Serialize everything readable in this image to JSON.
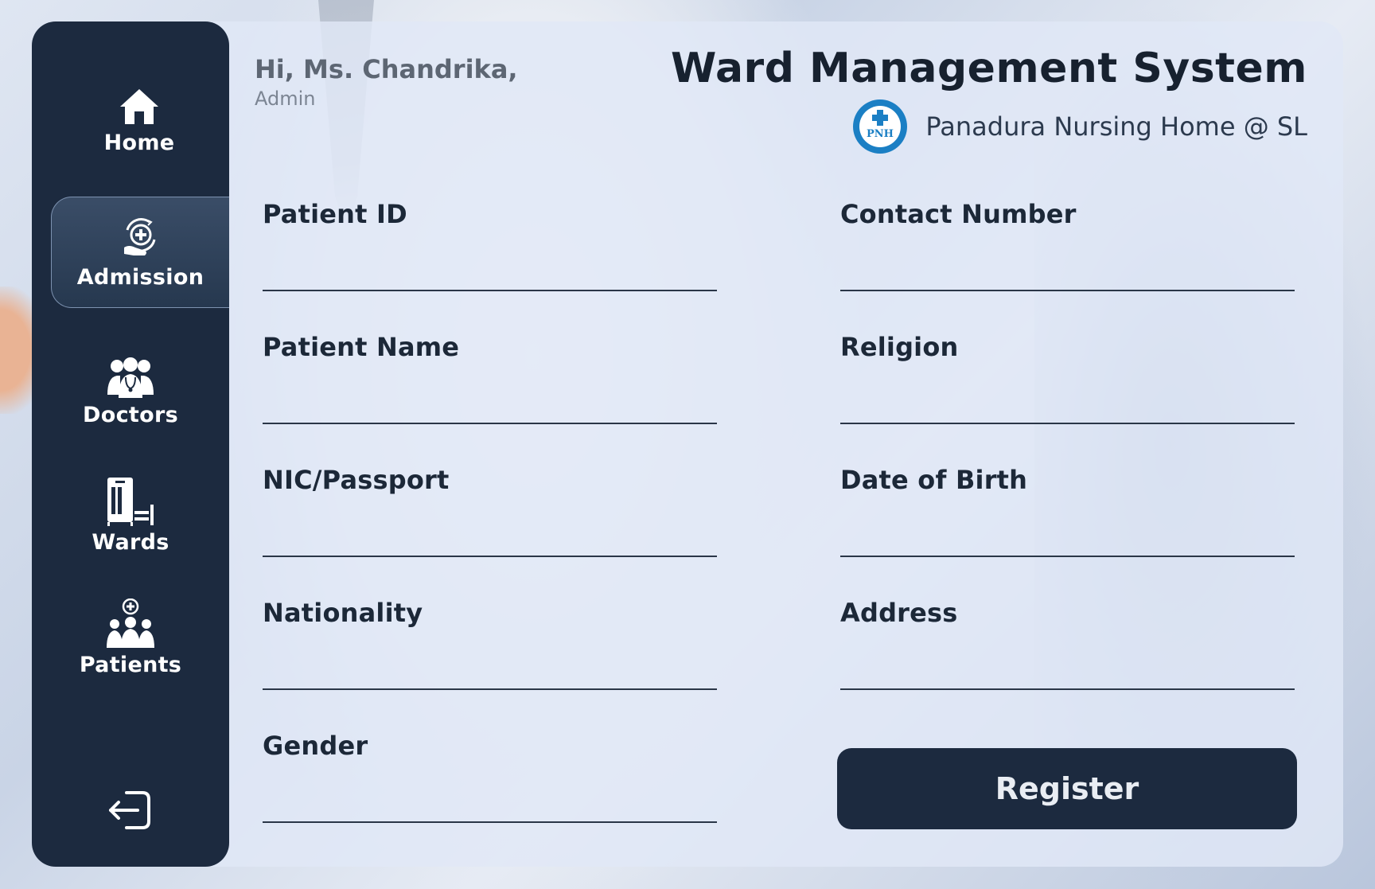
{
  "header": {
    "greeting": "Hi, Ms. Chandrika,",
    "role": "Admin",
    "app_title": "Ward Management System",
    "org_name": "Panadura Nursing Home @ SL",
    "logo_text": "PNH"
  },
  "sidebar": {
    "items": [
      {
        "label": "Home",
        "icon": "home-icon"
      },
      {
        "label": "Admission",
        "icon": "admission-icon",
        "active": true
      },
      {
        "label": "Doctors",
        "icon": "doctors-icon"
      },
      {
        "label": "Wards",
        "icon": "ward-bed-icon"
      },
      {
        "label": "Patients",
        "icon": "patients-icon"
      }
    ],
    "logout_icon": "logout-icon"
  },
  "form": {
    "fields": [
      {
        "label": "Patient ID",
        "value": ""
      },
      {
        "label": "Contact Number",
        "value": ""
      },
      {
        "label": "Patient Name",
        "value": ""
      },
      {
        "label": "Religion",
        "value": ""
      },
      {
        "label": "NIC/Passport",
        "value": ""
      },
      {
        "label": "Date of Birth",
        "value": ""
      },
      {
        "label": "Nationality",
        "value": ""
      },
      {
        "label": "Address",
        "value": ""
      },
      {
        "label": "Gender",
        "value": ""
      }
    ],
    "submit_label": "Register"
  },
  "colors": {
    "sidebar_bg": "#1c2a3f",
    "panel_bg": "#e1e8f7",
    "text_dark": "#17212f",
    "logo_blue": "#1b7fc4"
  }
}
